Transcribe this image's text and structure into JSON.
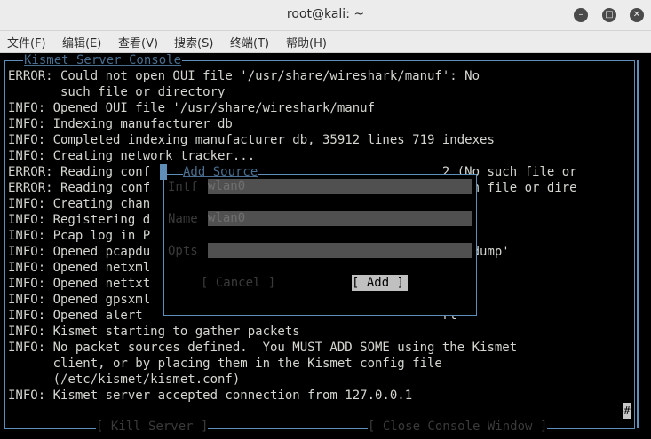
{
  "window": {
    "title": "root@kali: ~",
    "minimize": "–",
    "maximize": "□",
    "close": "✕"
  },
  "menu": [
    "文件(F)",
    "编辑(E)",
    "查看(V)",
    "搜索(S)",
    "终端(T)",
    "帮助(H)"
  ],
  "console": {
    "caption": "Kismet Server Console",
    "lines": [
      "ERROR: Could not open OUI file '/usr/share/wireshark/manuf': No",
      "       such file or directory",
      "INFO: Opened OUI file '/usr/share/wireshark/manuf",
      "INFO: Indexing manufacturer db",
      "INFO: Completed indexing manufacturer db, 35912 lines 719 indexes",
      "INFO: Creating network tracker...",
      "ERROR: Reading conf                                       2 (No such file or",
      "ERROR: Reading conf                                        such file or dire",
      "INFO: Creating chan",
      "INFO: Registering d",
      "INFO: Pcap log in P",
      "INFO: Opened pcapdu                                       pcapdump'",
      "INFO: Opened netxml                                       txml'",
      "INFO: Opened nettxt                                       ttxt'",
      "INFO: Opened gpsxml                                       sxml'",
      "INFO: Opened alert                                        rt'",
      "INFO: Kismet starting to gather packets",
      "INFO: No packet sources defined.  You MUST ADD SOME using the Kismet",
      "      client, or by placing them in the Kismet config file",
      "      (/etc/kismet/kismet.conf)",
      "INFO: Kismet server accepted connection from 127.0.0.1"
    ],
    "kill_button": "[ Kill Server ]",
    "close_button": "[ Close Console Window ]",
    "scroll_marker": "#"
  },
  "dialog": {
    "title": "Add Source",
    "intf_label": "Intf",
    "intf_value": "wlan0",
    "name_label": "Name",
    "name_value": "wlan0",
    "opts_label": "Opts",
    "opts_value": "",
    "cancel": "[ Cancel ]",
    "add": "[ Add ]"
  }
}
